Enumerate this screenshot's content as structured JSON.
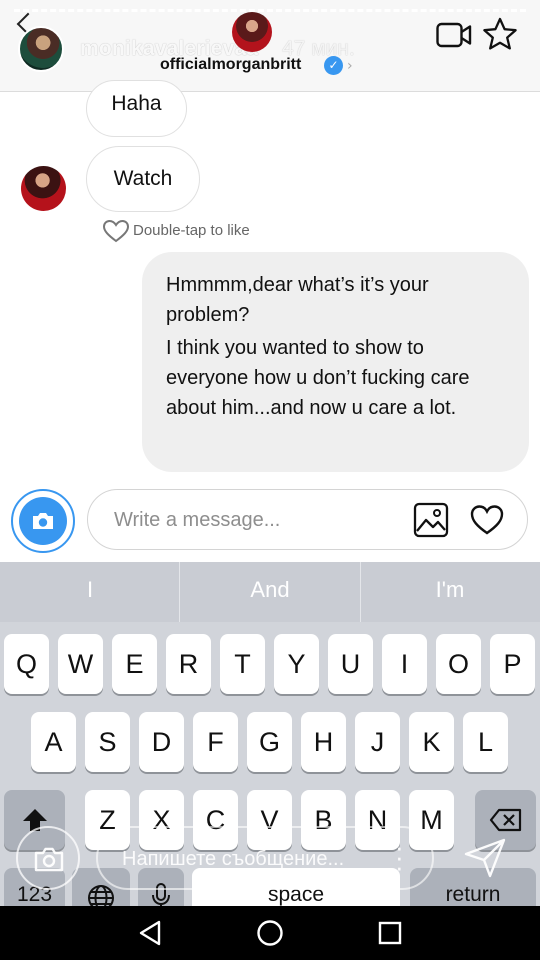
{
  "header": {
    "story_username": "monikavalerievaa",
    "story_time": "47 мин.",
    "thread_username": "officialmorganbritt",
    "verified_icon": "verified-badge-icon",
    "video_call_icon": "video-camera-icon",
    "favorite_icon": "star-icon"
  },
  "messages": [
    {
      "direction": "incoming",
      "text": "Haha"
    },
    {
      "direction": "incoming",
      "text": "Watch"
    },
    {
      "direction": "outgoing",
      "paragraphs": [
        "Hmmmm,dear what’s it’s your problem?",
        "I think you wanted to show to everyone how u don’t fucking care about him...and now u care a lot."
      ]
    }
  ],
  "like_hint": "Double-tap to like",
  "composer": {
    "placeholder": "Write a message...",
    "camera_icon": "camera-icon",
    "gallery_icon": "image-gallery-icon",
    "heart_icon": "heart-icon"
  },
  "keyboard": {
    "suggestions": [
      "I",
      "And",
      "I'm"
    ],
    "row1": [
      "Q",
      "W",
      "E",
      "R",
      "T",
      "Y",
      "U",
      "I",
      "O",
      "P"
    ],
    "row2": [
      "A",
      "S",
      "D",
      "F",
      "G",
      "H",
      "J",
      "K",
      "L"
    ],
    "row3": [
      "Z",
      "X",
      "C",
      "V",
      "B",
      "N",
      "M"
    ],
    "numbers_key": "123",
    "space_key": "space",
    "return_key": "return",
    "shift_icon": "shift-arrow-icon",
    "delete_icon": "backspace-icon",
    "globe_icon": "globe-icon",
    "mic_icon": "microphone-icon"
  },
  "overlay": {
    "placeholder": "Напишете съобщение...",
    "camera_icon": "camera-icon",
    "send_icon": "send-arrow-icon"
  },
  "colors": {
    "accent": "#3897f0",
    "outgoing_bubble": "#efefef",
    "keyboard_bg": "#d1d4da"
  }
}
